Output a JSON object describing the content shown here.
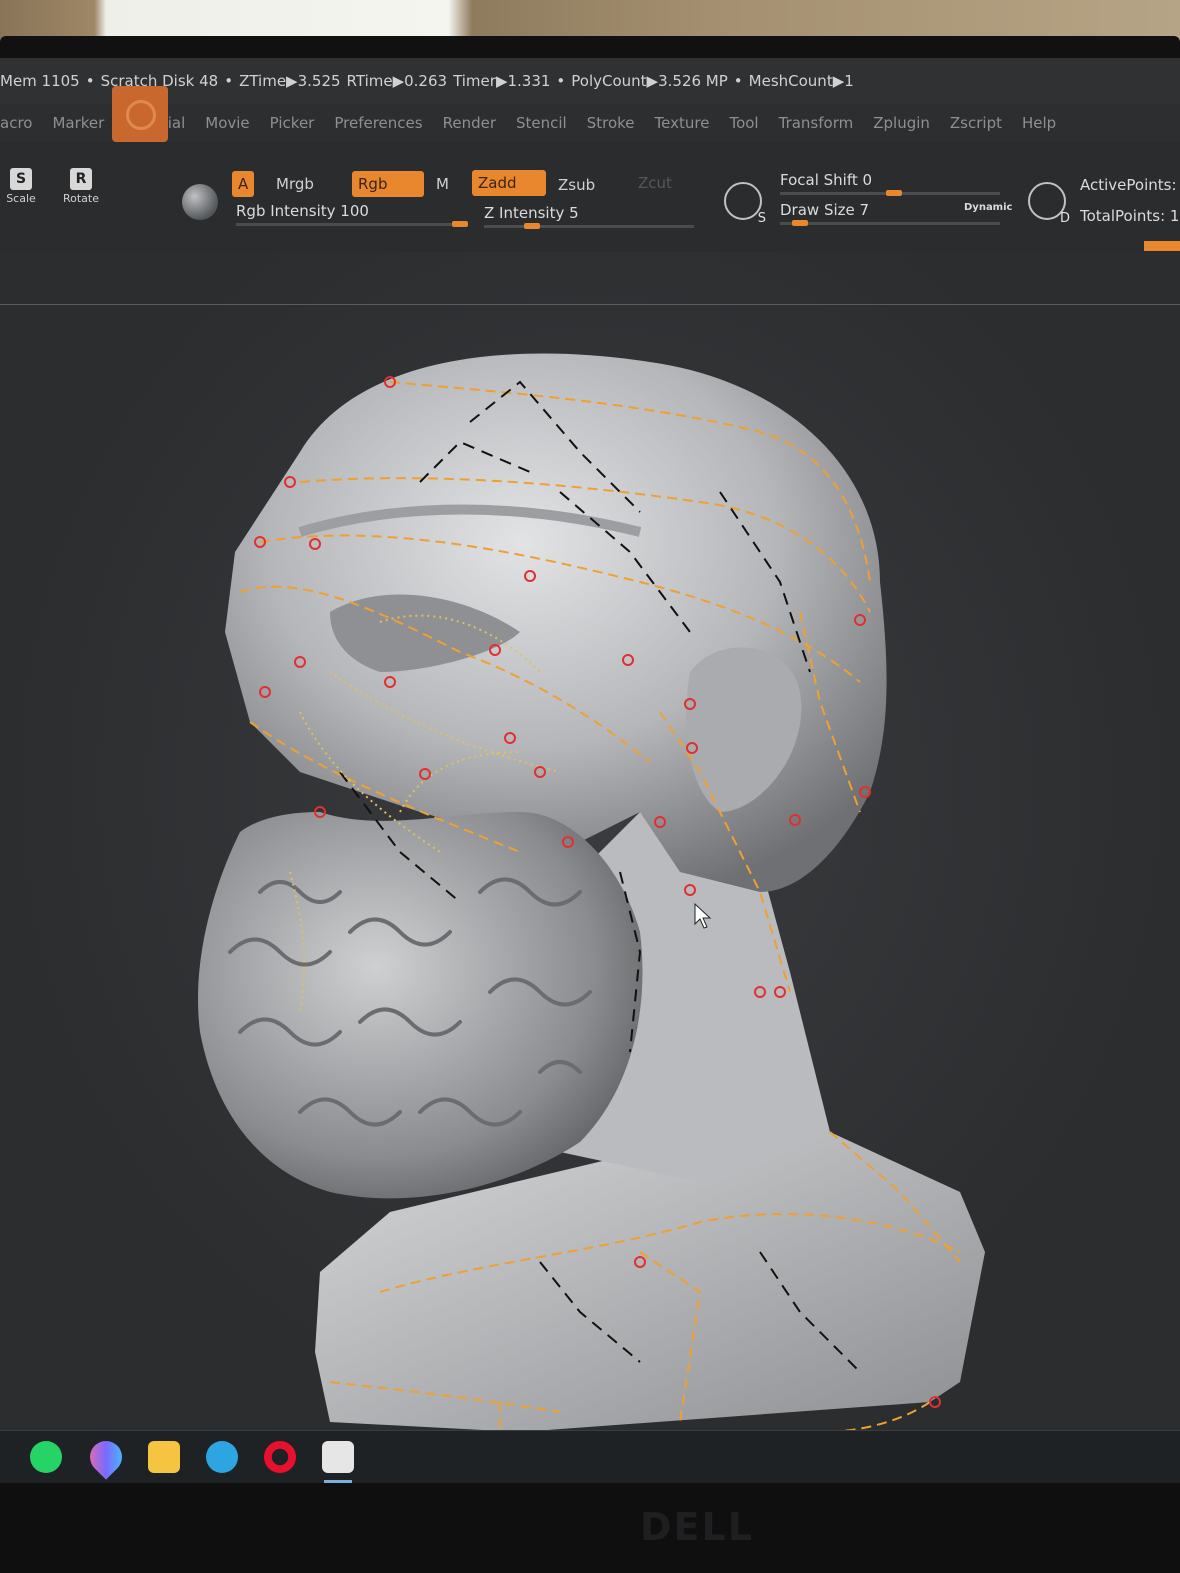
{
  "status": {
    "mem": "Mem 1105",
    "scratch": "Scratch Disk 48",
    "ztime": "ZTime▶3.525",
    "rtime": "RTime▶0.263",
    "timer": "Timer▶1.331",
    "polycount": "PolyCount▶3.526 MP",
    "meshcount": "MeshCount▶1"
  },
  "menu": {
    "items": [
      "acro",
      "Marker",
      "Material",
      "Movie",
      "Picker",
      "Preferences",
      "Render",
      "Stencil",
      "Stroke",
      "Texture",
      "Tool",
      "Transform",
      "Zplugin",
      "Zscript",
      "Help"
    ]
  },
  "toolbar": {
    "scale_label": "Scale",
    "scale_key": "S",
    "rotate_label": "Rotate",
    "rotate_key": "R",
    "a_label": "A",
    "mrgb_label": "Mrgb",
    "rgb_label": "Rgb",
    "m_label": "M",
    "zadd_label": "Zadd",
    "zsub_label": "Zsub",
    "zcut_label": "Zcut",
    "rgb_intensity": "Rgb Intensity 100",
    "rgb_intensity_value": 100,
    "z_intensity": "Z Intensity 5",
    "z_intensity_value": 5,
    "focal_shift": "Focal Shift 0",
    "draw_size": "Draw Size 7",
    "dynamic_label": "Dynamic",
    "s_key": "S",
    "d_key": "D",
    "active_points": "ActivePoints:",
    "total_points": "TotalPoints: 1"
  },
  "colors": {
    "accent": "#e8872e",
    "topology_orange": "#f0a030",
    "topology_black": "#111111",
    "marker_red": "#e03030"
  },
  "taskbar": {
    "icons": [
      "whatsapp-icon",
      "paint-drop-icon",
      "file-explorer-icon",
      "telegram-icon",
      "opera-icon",
      "zbrush-icon"
    ]
  },
  "monitor": {
    "brand": "DELL"
  }
}
